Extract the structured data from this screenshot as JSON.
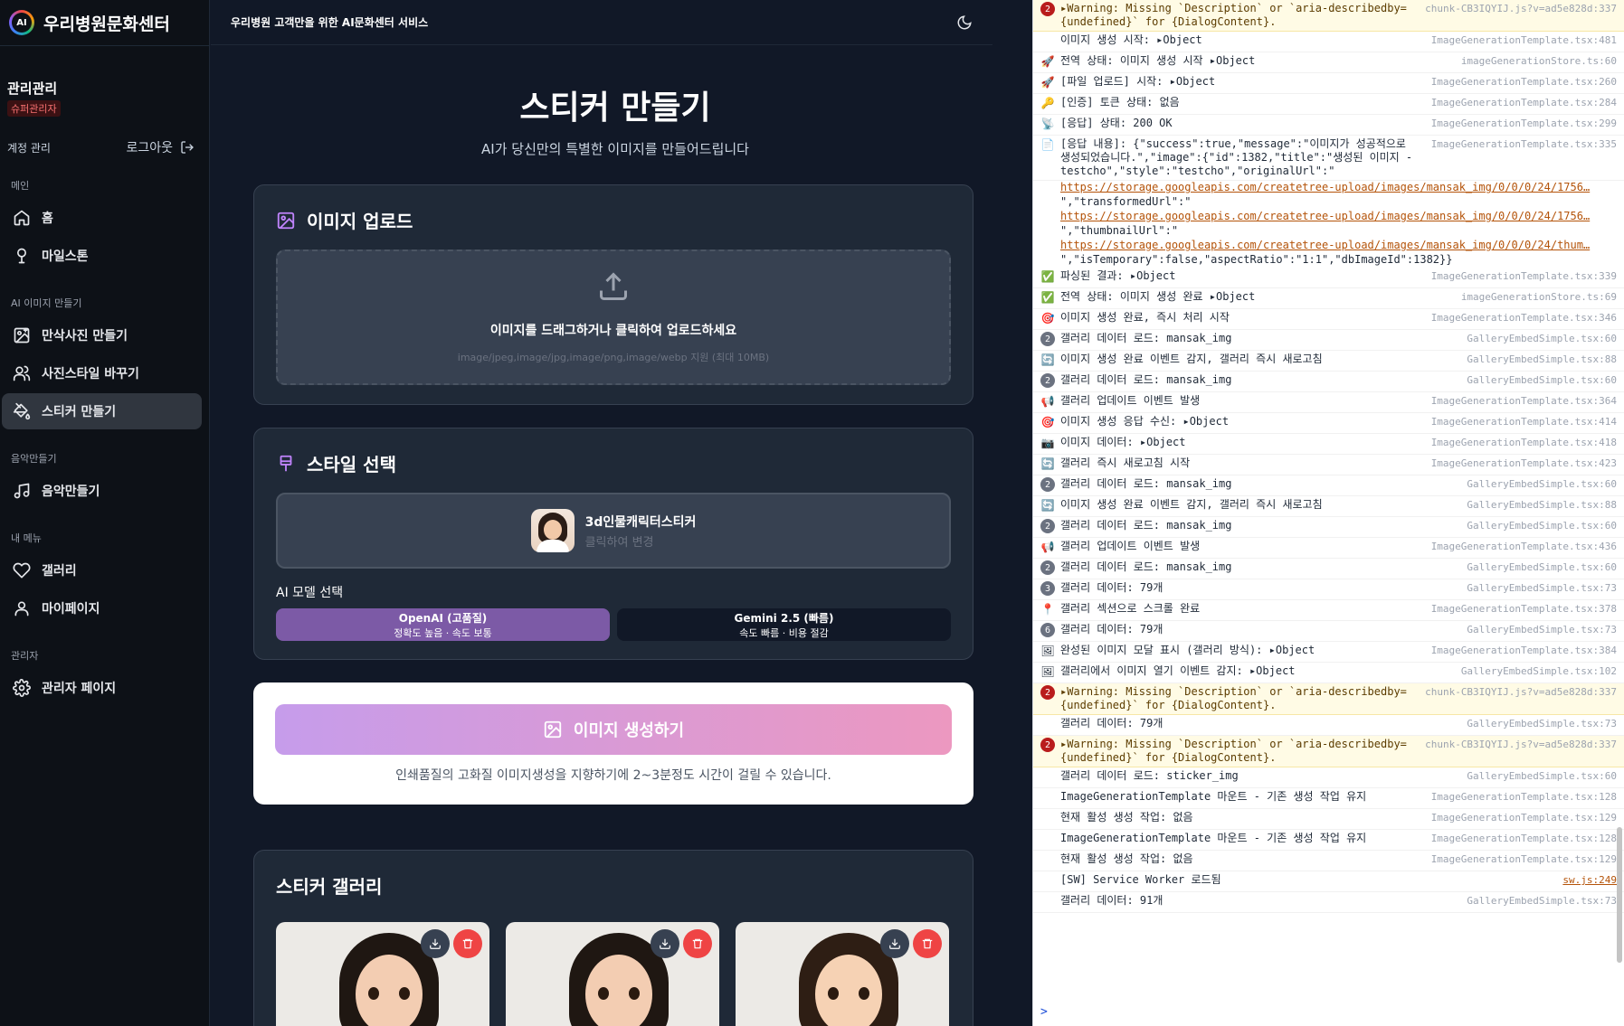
{
  "brand": {
    "name": "우리병원문화센터",
    "logo_text": "AI"
  },
  "user": {
    "name": "관리관리",
    "role": "슈퍼관리자"
  },
  "account": {
    "label": "계정 관리",
    "logout": "로그아웃"
  },
  "nav": {
    "sections": [
      {
        "title": "메인",
        "items": [
          {
            "label": "홈",
            "icon": "home-icon"
          },
          {
            "label": "마일스톤",
            "icon": "milestone-icon"
          }
        ]
      },
      {
        "title": "AI 이미지 만들기",
        "items": [
          {
            "label": "만삭사진 만들기",
            "icon": "image-plus-icon"
          },
          {
            "label": "사진스타일 바꾸기",
            "icon": "users-icon"
          },
          {
            "label": "스티커 만들기",
            "icon": "paint-bucket-icon",
            "active": true
          }
        ]
      },
      {
        "title": "음악만들기",
        "items": [
          {
            "label": "음악만들기",
            "icon": "music-icon"
          }
        ]
      },
      {
        "title": "내 메뉴",
        "items": [
          {
            "label": "갤러리",
            "icon": "heart-icon"
          },
          {
            "label": "마이페이지",
            "icon": "user-icon"
          }
        ]
      },
      {
        "title": "관리자",
        "items": [
          {
            "label": "관리자 페이지",
            "icon": "gear-icon"
          }
        ]
      }
    ]
  },
  "topbar": {
    "title": "우리병원 고객만을 위한 AI문화센터 서비스"
  },
  "page": {
    "title": "스티커 만들기",
    "subtitle": "AI가 당신만의 특별한 이미지를 만들어드립니다"
  },
  "upload": {
    "title": "이미지 업로드",
    "instruction": "이미지를 드래그하거나 클릭하여 업로드하세요",
    "hint": "image/jpeg,image/jpg,image/png,image/webp 지원 (최대 10MB)"
  },
  "style": {
    "title": "스타일 선택",
    "selected_name": "3d인물캐릭터스티커",
    "change_text": "클릭하여 변경",
    "model_label": "AI 모델 선택",
    "models": [
      {
        "name": "OpenAI (고품질)",
        "desc": "정확도 높음 · 속도 보통",
        "selected": true
      },
      {
        "name": "Gemini 2.5 (빠름)",
        "desc": "속도 빠름 · 비용 절감",
        "selected": false
      }
    ]
  },
  "generate": {
    "button": "이미지 생성하기",
    "note": "인쇄품질의 고화질 이미지생성을 지향하기에 2~3분정도 시간이 걸릴 수 있습니다."
  },
  "gallery": {
    "title": "스티커 갤러리"
  },
  "console": {
    "logs": [
      {
        "type": "warn",
        "badge": "2",
        "msg": "▸Warning: Missing `Description` or `aria-describedby={undefined}` for {DialogContent}.",
        "src": "chunk-CB3IQYIJ.js?v=ad5e828d:337"
      },
      {
        "type": "log",
        "badge": "",
        "emoji": "",
        "msg": "이미지 생성 시작: ▸Object",
        "src": "ImageGenerationTemplate.tsx:481"
      },
      {
        "type": "log",
        "emoji": "🚀",
        "msg": "전역 상태: 이미지 생성 시작 ▸Object",
        "src": "imageGenerationStore.ts:60"
      },
      {
        "type": "log",
        "emoji": "🚀",
        "msg": "[파일 업로드] 시작: ▸Object",
        "src": "ImageGenerationTemplate.tsx:260"
      },
      {
        "type": "log",
        "emoji": "🔑",
        "msg": "[인증] 토큰 상태: 없음",
        "src": "ImageGenerationTemplate.tsx:284"
      },
      {
        "type": "log",
        "emoji": "📡",
        "msg": "[응답] 상태: 200 OK",
        "src": "ImageGenerationTemplate.tsx:299"
      },
      {
        "type": "log",
        "emoji": "📄",
        "msg": "[응답 내용]: {\"success\":true,\"message\":\"이미지가 성공적으로 생성되었습니다.\",\"image\":{\"id\":1382,\"title\":\"생성된 이미지 - testcho\",\"style\":\"testcho\",\"originalUrl\":\"",
        "src": "ImageGenerationTemplate.tsx:335"
      },
      {
        "type": "url",
        "msg": "https://storage.googleapis.com/createtree-upload/images/mansak_img/0/0/0/24/1756…",
        "src": ""
      },
      {
        "type": "plain",
        "msg": "\",\"transformedUrl\":\"",
        "src": ""
      },
      {
        "type": "url",
        "msg": "https://storage.googleapis.com/createtree-upload/images/mansak_img/0/0/0/24/1756…",
        "src": ""
      },
      {
        "type": "plain",
        "msg": "\",\"thumbnailUrl\":\"",
        "src": ""
      },
      {
        "type": "url",
        "msg": "https://storage.googleapis.com/createtree-upload/images/mansak_img/0/0/0/24/thum…",
        "src": ""
      },
      {
        "type": "plain",
        "msg": "\",\"isTemporary\":false,\"aspectRatio\":\"1:1\",\"dbImageId\":1382}}",
        "src": ""
      },
      {
        "type": "log",
        "emoji": "✅",
        "msg": "파싱된 결과: ▸Object",
        "src": "ImageGenerationTemplate.tsx:339"
      },
      {
        "type": "log",
        "emoji": "✅",
        "msg": "전역 상태: 이미지 생성 완료 ▸Object",
        "src": "imageGenerationStore.ts:69"
      },
      {
        "type": "log",
        "emoji": "🎯",
        "msg": "이미지 생성 완료, 즉시 처리 시작",
        "src": "ImageGenerationTemplate.tsx:346"
      },
      {
        "type": "log",
        "badge": "2",
        "msg": "갤러리 데이터 로드: mansak_img",
        "src": "GalleryEmbedSimple.tsx:60"
      },
      {
        "type": "log",
        "emoji": "🔄",
        "msg": "이미지 생성 완료 이벤트 감지, 갤러리 즉시 새로고침",
        "src": "GalleryEmbedSimple.tsx:88"
      },
      {
        "type": "log",
        "badge": "2",
        "msg": "갤러리 데이터 로드: mansak_img",
        "src": "GalleryEmbedSimple.tsx:60"
      },
      {
        "type": "log",
        "emoji": "📢",
        "msg": "갤러리 업데이트 이벤트 발생",
        "src": "ImageGenerationTemplate.tsx:364"
      },
      {
        "type": "log",
        "emoji": "🎯",
        "msg": "이미지 생성 응답 수신: ▸Object",
        "src": "ImageGenerationTemplate.tsx:414"
      },
      {
        "type": "log",
        "emoji": "📷",
        "msg": "이미지 데이터: ▸Object",
        "src": "ImageGenerationTemplate.tsx:418"
      },
      {
        "type": "log",
        "emoji": "🔄",
        "msg": "갤러리 즉시 새로고침 시작",
        "src": "ImageGenerationTemplate.tsx:423"
      },
      {
        "type": "log",
        "badge": "2",
        "msg": "갤러리 데이터 로드: mansak_img",
        "src": "GalleryEmbedSimple.tsx:60"
      },
      {
        "type": "log",
        "emoji": "🔄",
        "msg": "이미지 생성 완료 이벤트 감지, 갤러리 즉시 새로고침",
        "src": "GalleryEmbedSimple.tsx:88"
      },
      {
        "type": "log",
        "badge": "2",
        "msg": "갤러리 데이터 로드: mansak_img",
        "src": "GalleryEmbedSimple.tsx:60"
      },
      {
        "type": "log",
        "emoji": "📢",
        "msg": "갤러리 업데이트 이벤트 발생",
        "src": "ImageGenerationTemplate.tsx:436"
      },
      {
        "type": "log",
        "badge": "2",
        "msg": "갤러리 데이터 로드: mansak_img",
        "src": "GalleryEmbedSimple.tsx:60"
      },
      {
        "type": "log",
        "badge": "3",
        "msg": "갤러리 데이터: 79개",
        "src": "GalleryEmbedSimple.tsx:73"
      },
      {
        "type": "log",
        "emoji": "📍",
        "msg": "갤러리 섹션으로 스크롤 완료",
        "src": "ImageGenerationTemplate.tsx:378"
      },
      {
        "type": "log",
        "badge": "6",
        "msg": "갤러리 데이터: 79개",
        "src": "GalleryEmbedSimple.tsx:73"
      },
      {
        "type": "log",
        "emoji": "🖼",
        "msg": "완성된 이미지 모달 표시 (갤러리 방식): ▸Object",
        "src": "ImageGenerationTemplate.tsx:384"
      },
      {
        "type": "log",
        "emoji": "🖼",
        "msg": "갤러리에서 이미지 열기 이벤트 감지: ▸Object",
        "src": "GalleryEmbedSimple.tsx:102"
      },
      {
        "type": "warn",
        "badge": "2",
        "msg": "▸Warning: Missing `Description` or `aria-describedby={undefined}` for {DialogContent}.",
        "src": "chunk-CB3IQYIJ.js?v=ad5e828d:337"
      },
      {
        "type": "log",
        "msg": "갤러리 데이터: 79개",
        "src": "GalleryEmbedSimple.tsx:73"
      },
      {
        "type": "warn",
        "badge": "2",
        "msg": "▸Warning: Missing `Description` or `aria-describedby={undefined}` for {DialogContent}.",
        "src": "chunk-CB3IQYIJ.js?v=ad5e828d:337"
      },
      {
        "type": "log",
        "msg": "갤러리 데이터 로드: sticker_img",
        "src": "GalleryEmbedSimple.tsx:60"
      },
      {
        "type": "log",
        "msg": "ImageGenerationTemplate 마운트 - 기존 생성 작업 유지",
        "src": "ImageGenerationTemplate.tsx:128"
      },
      {
        "type": "log",
        "msg": "현재 활성 생성 작업: 없음",
        "src": "ImageGenerationTemplate.tsx:129"
      },
      {
        "type": "log",
        "msg": "ImageGenerationTemplate 마운트 - 기존 생성 작업 유지",
        "src": "ImageGenerationTemplate.tsx:128"
      },
      {
        "type": "log",
        "msg": "현재 활성 생성 작업: 없음",
        "src": "ImageGenerationTemplate.tsx:129"
      },
      {
        "type": "log",
        "msg": "[SW] Service Worker 로드됨",
        "src": "sw.js:249",
        "src_link": true
      },
      {
        "type": "log",
        "msg": "갤러리 데이터: 91개",
        "src": "GalleryEmbedSimple.tsx:73"
      }
    ],
    "prompt": ">"
  }
}
